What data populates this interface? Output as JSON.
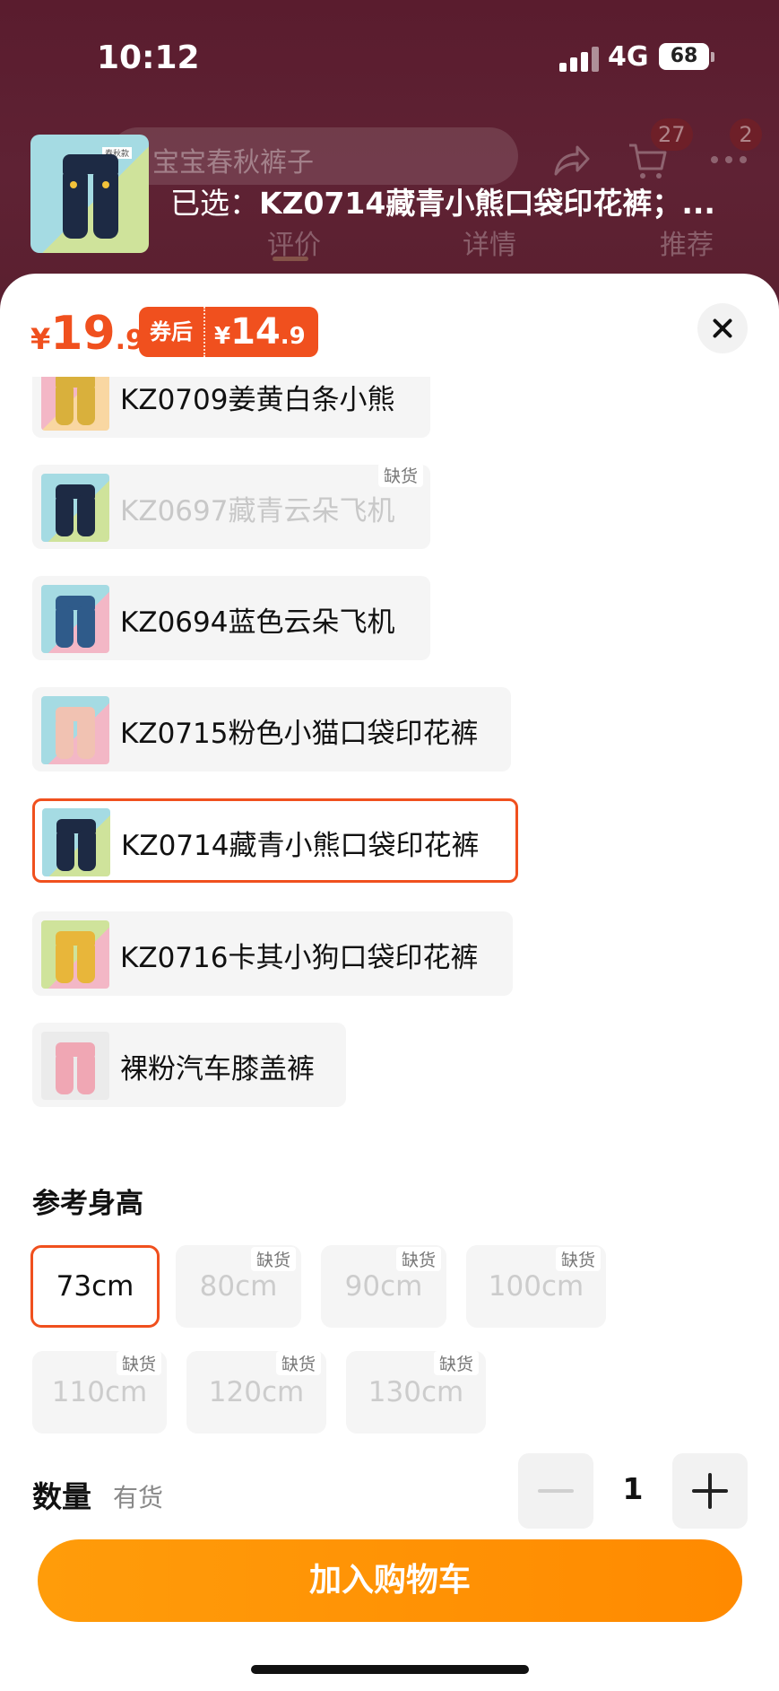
{
  "status_bar": {
    "time": "10:12",
    "network": "4G",
    "battery": "68"
  },
  "header": {
    "search_placeholder": "宝宝春秋裤子",
    "cart_count": "27",
    "more_count": "2",
    "tabs": [
      "评价",
      "详情",
      "推荐"
    ],
    "selected_prefix": "已选：",
    "selected_value": "KZ0714藏青小熊口袋印花裤；...",
    "thumb_tag": "春秋款"
  },
  "price": {
    "yen": "¥",
    "integer": "19",
    "decimal": ".9"
  },
  "coupon": {
    "label": "券后",
    "yen": "¥",
    "integer": "14",
    "decimal": ".9"
  },
  "options": [
    {
      "label": "KZ0709姜黄白条小熊",
      "out_of_stock": false,
      "selected": false
    },
    {
      "label": "KZ0697藏青云朵飞机",
      "out_of_stock": true,
      "selected": false
    },
    {
      "label": "KZ0694蓝色云朵飞机",
      "out_of_stock": false,
      "selected": false
    },
    {
      "label": "KZ0715粉色小猫口袋印花裤",
      "out_of_stock": false,
      "selected": false
    },
    {
      "label": "KZ0714藏青小熊口袋印花裤",
      "out_of_stock": false,
      "selected": true
    },
    {
      "label": "KZ0716卡其小狗口袋印花裤",
      "out_of_stock": false,
      "selected": false
    },
    {
      "label": "裸粉汽车膝盖裤",
      "out_of_stock": false,
      "selected": false
    }
  ],
  "out_of_stock_tag": "缺货",
  "height_section": {
    "title": "参考身高",
    "sizes": [
      {
        "label": "73cm",
        "out_of_stock": false,
        "selected": true
      },
      {
        "label": "80cm",
        "out_of_stock": true,
        "selected": false
      },
      {
        "label": "90cm",
        "out_of_stock": true,
        "selected": false
      },
      {
        "label": "100cm",
        "out_of_stock": true,
        "selected": false
      },
      {
        "label": "110cm",
        "out_of_stock": true,
        "selected": false
      },
      {
        "label": "120cm",
        "out_of_stock": true,
        "selected": false
      },
      {
        "label": "130cm",
        "out_of_stock": true,
        "selected": false
      }
    ]
  },
  "quantity": {
    "label": "数量",
    "stock_status": "有货",
    "value": "1"
  },
  "add_to_cart": "加入购物车",
  "colors": {
    "accent": "#f0501e",
    "cart_button": "#ff8f00"
  },
  "icons": [
    "share-icon",
    "cart-icon",
    "more-icon",
    "close-icon",
    "minus-icon",
    "plus-icon"
  ]
}
